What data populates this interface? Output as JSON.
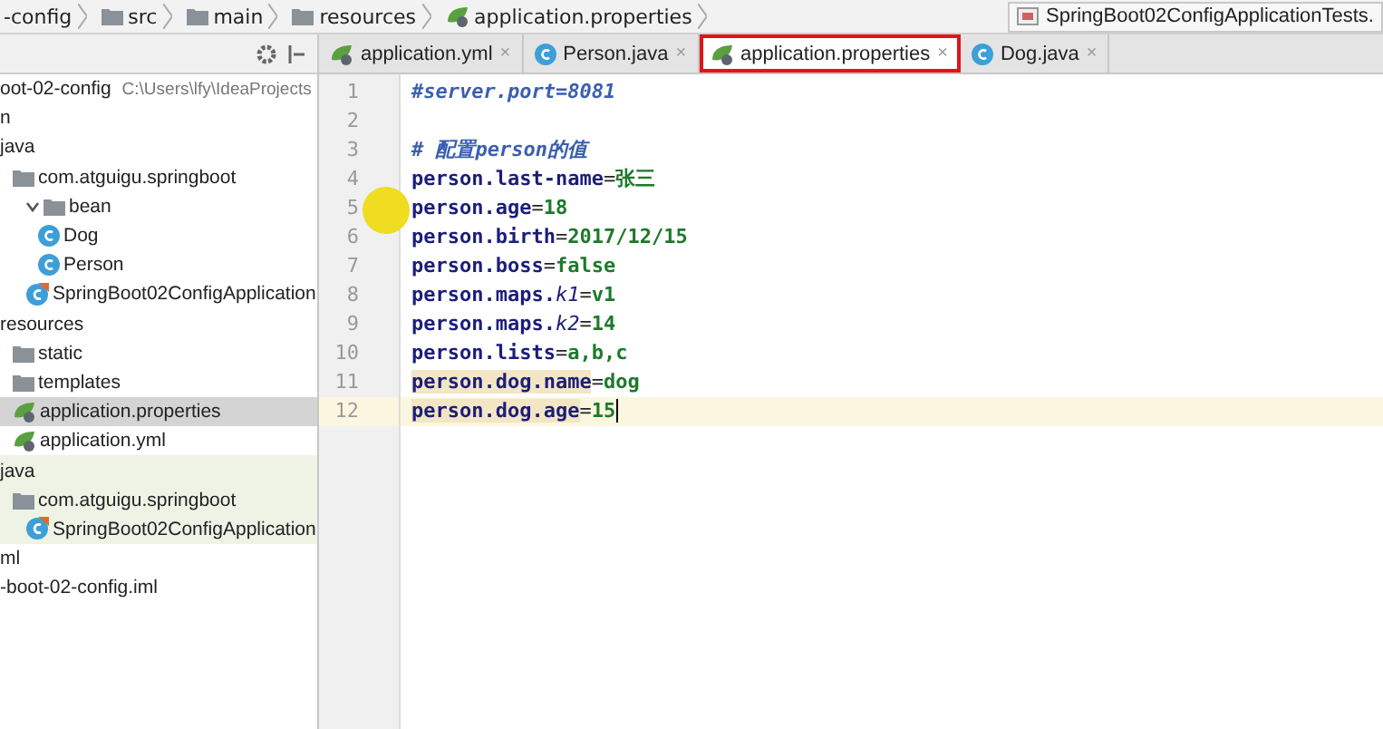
{
  "breadcrumb": [
    "-config",
    "src",
    "main",
    "resources",
    "application.properties"
  ],
  "run_config": "SpringBoot02ConfigApplicationTests.",
  "project_tree": [
    {
      "label": "oot-02-config",
      "path": "C:\\Users\\lfy\\IdeaProjects",
      "selected": false,
      "test": false
    },
    {
      "label": "n",
      "selected": false,
      "test": false
    },
    {
      "label": "java",
      "selected": false,
      "test": false,
      "children": [
        {
          "label": "com.atguigu.springboot",
          "kind": "folder",
          "selected": false,
          "test": false,
          "children": [
            {
              "label": "bean",
              "kind": "folder",
              "expanded": true,
              "selected": false,
              "test": false,
              "children": [
                {
                  "label": "Dog",
                  "kind": "class",
                  "selected": false,
                  "test": false
                },
                {
                  "label": "Person",
                  "kind": "class",
                  "selected": false,
                  "test": false
                }
              ]
            },
            {
              "label": "SpringBoot02ConfigApplication",
              "kind": "spring-class",
              "selected": false,
              "test": false
            }
          ]
        }
      ]
    },
    {
      "label": "resources",
      "selected": false,
      "test": false,
      "children": [
        {
          "label": "static",
          "kind": "folder",
          "selected": false,
          "test": false
        },
        {
          "label": "templates",
          "kind": "folder",
          "selected": false,
          "test": false
        },
        {
          "label": "application.properties",
          "kind": "spring",
          "selected": true,
          "test": false
        },
        {
          "label": "application.yml",
          "kind": "spring",
          "selected": false,
          "test": false
        }
      ]
    },
    {
      "label": "java",
      "selected": false,
      "test": true,
      "children": [
        {
          "label": "com.atguigu.springboot",
          "kind": "folder",
          "selected": false,
          "test": true,
          "children": [
            {
              "label": "SpringBoot02ConfigApplication",
              "kind": "spring-class",
              "selected": false,
              "test": true
            }
          ]
        }
      ]
    },
    {
      "label": "ml",
      "selected": false,
      "test": false
    },
    {
      "label": "-boot-02-config.iml",
      "selected": false,
      "test": false
    }
  ],
  "tabs": [
    {
      "label": "application.yml",
      "kind": "spring",
      "selected": false,
      "annotated": false,
      "close": "×"
    },
    {
      "label": "Person.java",
      "kind": "class",
      "selected": false,
      "annotated": false,
      "close": "×"
    },
    {
      "label": "application.properties",
      "kind": "spring",
      "selected": true,
      "annotated": true,
      "close": "×"
    },
    {
      "label": "Dog.java",
      "kind": "class",
      "selected": false,
      "annotated": false,
      "close": "×"
    }
  ],
  "editor_lines": [
    {
      "number": "1",
      "current": false,
      "segments": [
        {
          "text": "#server.port=8081",
          "kind": "comment"
        }
      ]
    },
    {
      "number": "2",
      "current": false
    },
    {
      "number": "3",
      "current": false,
      "segments": [
        {
          "text": "# 配置",
          "kind": "comment"
        },
        {
          "text": "person",
          "kind": "comment"
        },
        {
          "text": "的值",
          "kind": "comment"
        }
      ]
    },
    {
      "number": "4",
      "current": false,
      "segments": [
        {
          "text": "person.last-name",
          "kind": "key"
        },
        {
          "text": "=",
          "kind": "eq"
        },
        {
          "text": "张三",
          "kind": "value"
        }
      ]
    },
    {
      "number": "5",
      "current": false,
      "segments": [
        {
          "text": "person.age",
          "kind": "key"
        },
        {
          "text": "=",
          "kind": "eq"
        },
        {
          "text": "18",
          "kind": "value"
        }
      ]
    },
    {
      "number": "6",
      "current": false,
      "segments": [
        {
          "text": "person.birth",
          "kind": "key"
        },
        {
          "text": "=",
          "kind": "eq"
        },
        {
          "text": "2017/12/15",
          "kind": "value"
        }
      ]
    },
    {
      "number": "7",
      "current": false,
      "segments": [
        {
          "text": "person.boss",
          "kind": "key"
        },
        {
          "text": "=",
          "kind": "eq"
        },
        {
          "text": "false",
          "kind": "value"
        }
      ]
    },
    {
      "number": "8",
      "current": false,
      "segments": [
        {
          "text": "person.maps.",
          "kind": "key"
        },
        {
          "text": "k1",
          "kind": "map-key"
        },
        {
          "text": "=",
          "kind": "eq"
        },
        {
          "text": "v1",
          "kind": "value"
        }
      ]
    },
    {
      "number": "9",
      "current": false,
      "segments": [
        {
          "text": "person.maps.",
          "kind": "key"
        },
        {
          "text": "k2",
          "kind": "map-key"
        },
        {
          "text": "=",
          "kind": "eq"
        },
        {
          "text": "14",
          "kind": "value"
        }
      ]
    },
    {
      "number": "10",
      "current": false,
      "segments": [
        {
          "text": "person.lists",
          "kind": "key"
        },
        {
          "text": "=",
          "kind": "eq"
        },
        {
          "text": "a,b,c",
          "kind": "value"
        }
      ]
    },
    {
      "number": "11",
      "current": false,
      "segments": [
        {
          "text": "person.dog.name",
          "kind": "key-highlighted"
        },
        {
          "text": "=",
          "kind": "eq"
        },
        {
          "text": "dog",
          "kind": "value"
        }
      ]
    },
    {
      "number": "12",
      "current": true,
      "segments": [
        {
          "text": "person.dog.age",
          "kind": "key-highlighted"
        },
        {
          "text": "=",
          "kind": "eq"
        },
        {
          "text": "15",
          "kind": "value"
        }
      ]
    }
  ]
}
